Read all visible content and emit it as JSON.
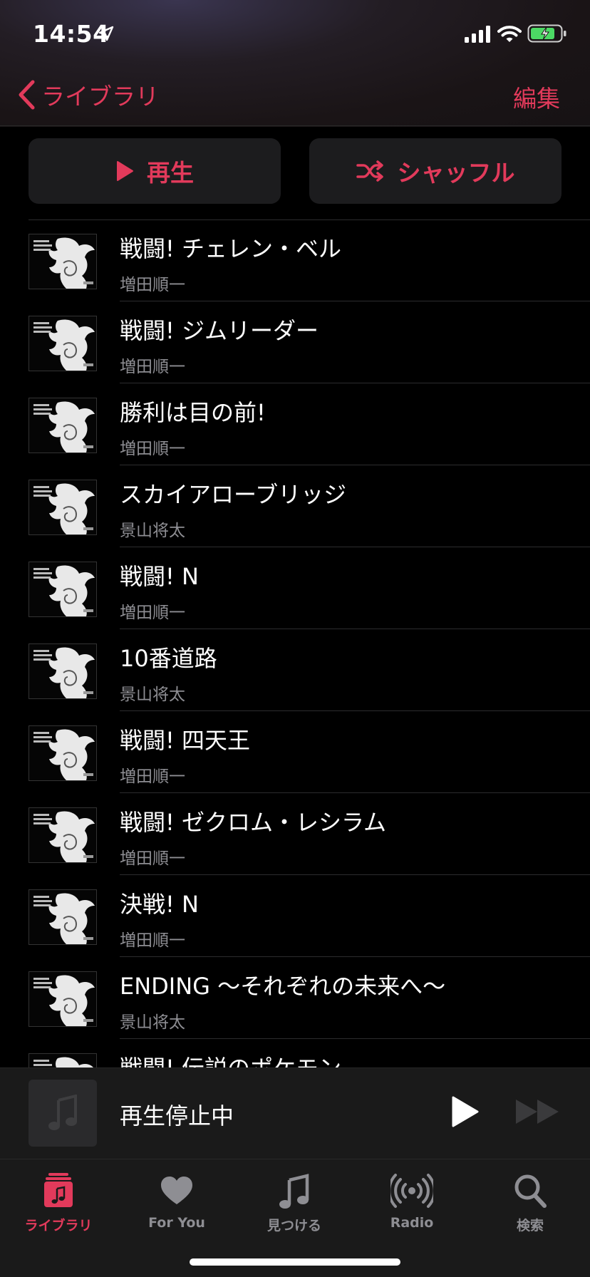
{
  "statusbar": {
    "time": "14:54"
  },
  "navbar": {
    "back_label": "ライブラリ",
    "edit_label": "編集"
  },
  "actions": {
    "play_label": "再生",
    "shuffle_label": "シャッフル"
  },
  "tracks": [
    {
      "title": "戦闘! チェレン・ベル",
      "artist": "増田順一"
    },
    {
      "title": "戦闘! ジムリーダー",
      "artist": "増田順一"
    },
    {
      "title": "勝利は目の前!",
      "artist": "増田順一"
    },
    {
      "title": "スカイアローブリッジ",
      "artist": "景山将太"
    },
    {
      "title": "戦闘! N",
      "artist": "増田順一"
    },
    {
      "title": "10番道路",
      "artist": "景山将太"
    },
    {
      "title": "戦闘! 四天王",
      "artist": "増田順一"
    },
    {
      "title": "戦闘! ゼクロム・レシラム",
      "artist": "増田順一"
    },
    {
      "title": "決戦! N",
      "artist": "増田順一"
    },
    {
      "title": "ENDING 〜それぞれの未来へ〜",
      "artist": "景山将太"
    },
    {
      "title": "戦闘! 伝説のポケモン",
      "artist": ""
    }
  ],
  "miniplayer": {
    "status": "再生停止中"
  },
  "tabs": [
    {
      "label": "ライブラリ",
      "icon": "library-icon",
      "active": true
    },
    {
      "label": "For You",
      "icon": "heart-icon",
      "active": false
    },
    {
      "label": "見つける",
      "icon": "music-note-icon",
      "active": false
    },
    {
      "label": "Radio",
      "icon": "radio-icon",
      "active": false
    },
    {
      "label": "検索",
      "icon": "search-icon",
      "active": false
    }
  ],
  "colors": {
    "accent": "#e23a5b",
    "secondary_text": "#8e8e93",
    "background": "#000000"
  }
}
